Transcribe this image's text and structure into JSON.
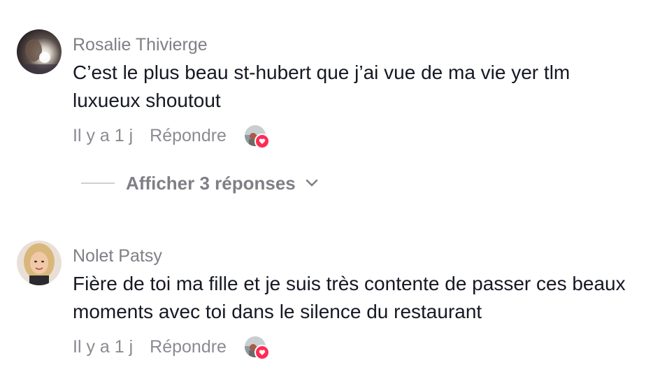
{
  "comments": [
    {
      "username": "Rosalie Thivierge",
      "text": "C’est le plus beau st-hubert que j’ai vue de ma vie yer tlm luxueux shoutout",
      "time": "Il y a 1 j",
      "reply_label": "Répondre",
      "view_replies_label": "Afficher 3 réponses"
    },
    {
      "username": "Nolet Patsy",
      "text": "Fière de toi ma fille et je suis très contente de passer ces beaux moments avec toi dans le silence du restaurant",
      "time": "Il y a 1 j",
      "reply_label": "Répondre"
    }
  ],
  "icons": {
    "creator_liked": "heart-icon",
    "expand": "chevron-down-icon"
  },
  "colors": {
    "heart_badge": "#fe2c55",
    "secondary_text": "#8a8b91",
    "primary_text": "#161823"
  }
}
